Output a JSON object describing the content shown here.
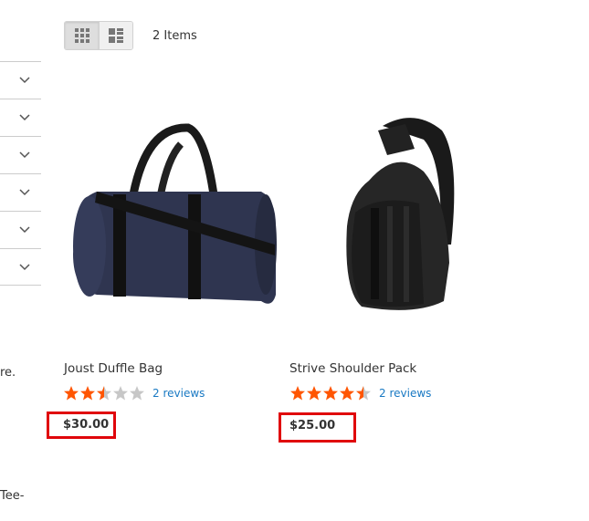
{
  "toolbar": {
    "modes": [
      {
        "name": "grid",
        "icon": "grid-icon",
        "active": true
      },
      {
        "name": "list",
        "icon": "list-icon",
        "active": false
      }
    ],
    "items_count": "2 Items"
  },
  "filters": {
    "count": 6,
    "icon": "chevron-down-icon"
  },
  "sidebar_fragments": [
    "re.",
    "Tee-"
  ],
  "products": [
    {
      "name": "Joust Duffle Bag",
      "rating": 2.5,
      "rating_max": 5,
      "reviews": "2 reviews",
      "price": "$30.00",
      "image": "duffle-bag-image"
    },
    {
      "name": "Strive Shoulder Pack",
      "rating": 4.5,
      "rating_max": 5,
      "reviews": "2 reviews",
      "price": "$25.00",
      "image": "shoulder-pack-image"
    }
  ],
  "colors": {
    "star_filled": "#ff5501",
    "star_empty": "#c7c7c7",
    "link": "#1979c3",
    "highlight": "#e0050b"
  }
}
